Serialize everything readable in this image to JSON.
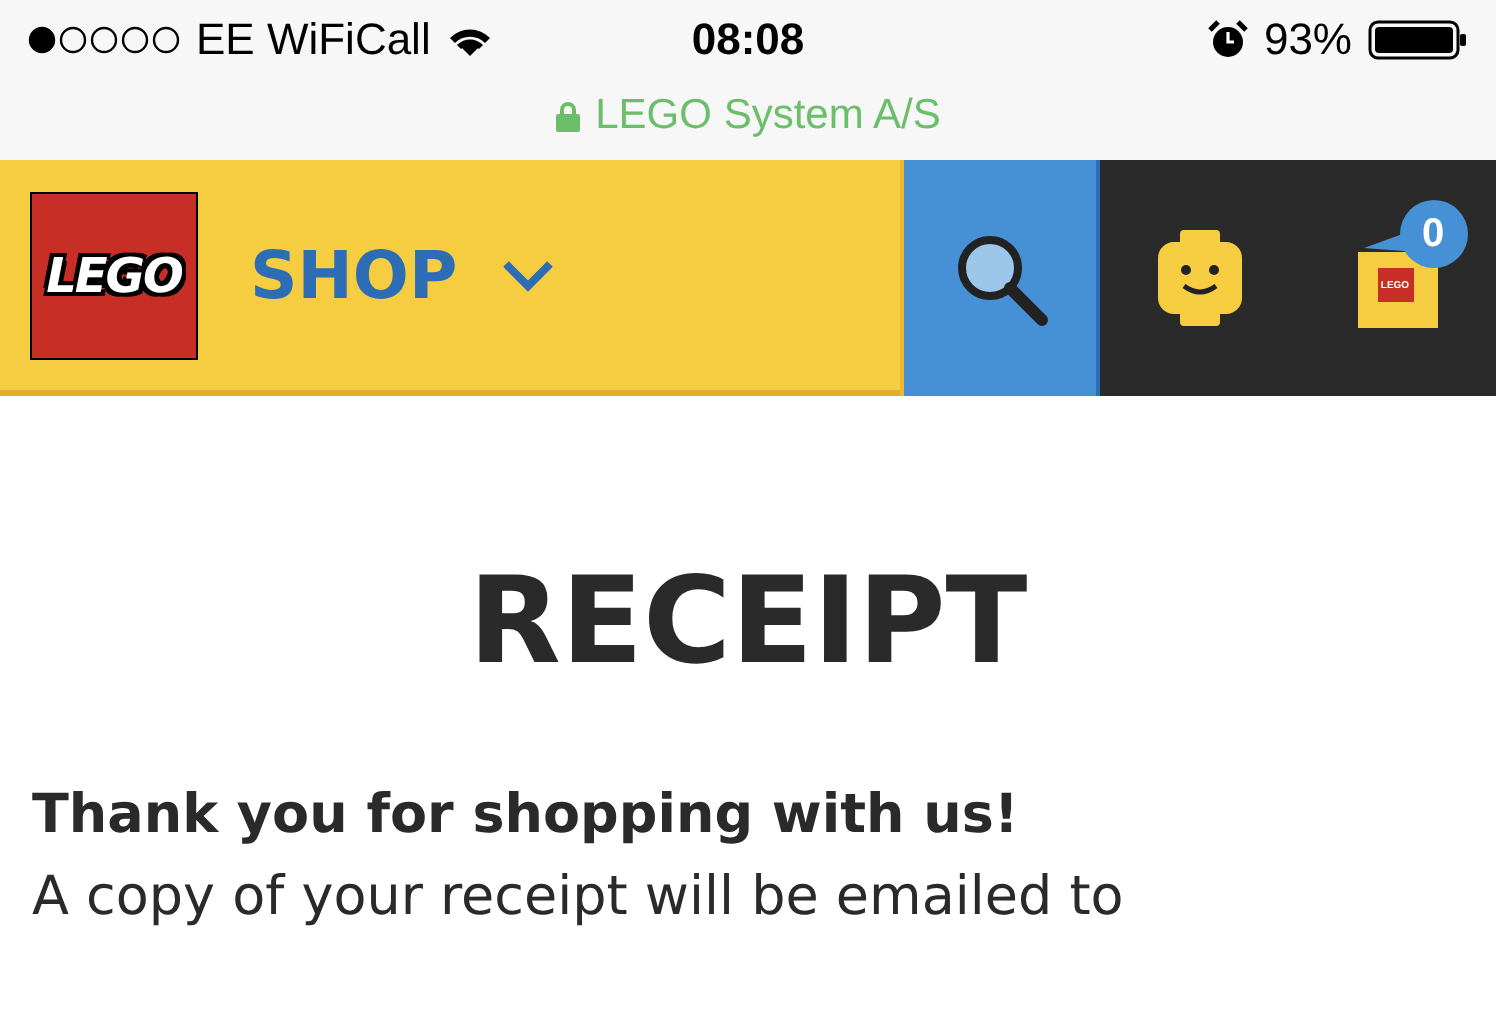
{
  "status_bar": {
    "carrier": "EE WiFiCall",
    "time": "08:08",
    "battery": "93%"
  },
  "address_bar": {
    "site": "LEGO System A/S"
  },
  "header": {
    "logo": "LEGO",
    "menu": "SHOP",
    "cart_count": "0",
    "bag_logo": "LEGO"
  },
  "content": {
    "title": "RECEIPT",
    "thanks": "Thank you for shopping with us!",
    "message": "A copy of your receipt will be emailed to"
  }
}
